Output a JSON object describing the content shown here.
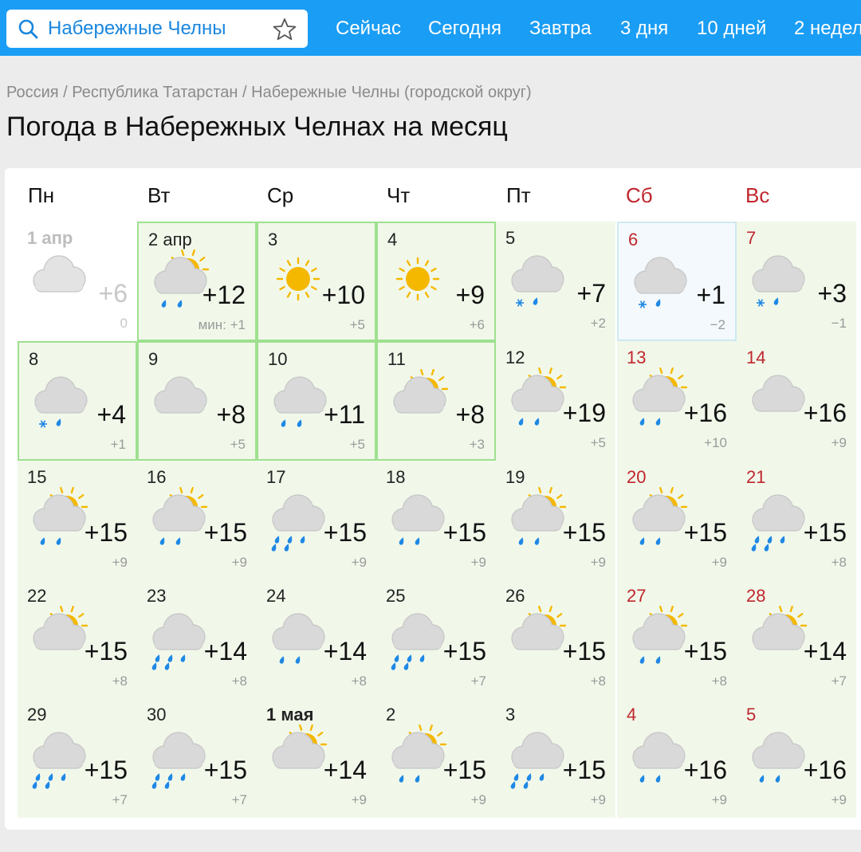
{
  "header": {
    "search_value": "Набережные Челны",
    "nav": [
      "Сейчас",
      "Сегодня",
      "Завтра",
      "3 дня",
      "10 дней",
      "2 недел"
    ]
  },
  "breadcrumb": [
    "Россия",
    "/",
    "Республика Татарстан",
    "/",
    "Набережные Челны (городской округ)"
  ],
  "page_title": "Погода в Набережных Челнах на месяц",
  "weekdays": [
    {
      "label": "Пн",
      "weekend": false
    },
    {
      "label": "Вт",
      "weekend": false
    },
    {
      "label": "Ср",
      "weekend": false
    },
    {
      "label": "Чт",
      "weekend": false
    },
    {
      "label": "Пт",
      "weekend": false
    },
    {
      "label": "Сб",
      "weekend": true
    },
    {
      "label": "Вс",
      "weekend": true
    }
  ],
  "colors": {
    "accent": "#1a9df4",
    "weekend": "#c0262d",
    "sun": "#f5b800",
    "rain": "#1e88e5",
    "cloud": "#d9d9d9"
  },
  "days": [
    {
      "date": "1 апр",
      "hi": "+6",
      "lo": "0",
      "icon": "cloud",
      "state": "past"
    },
    {
      "date": "2 апр",
      "hi": "+12",
      "lo": "мин: +1",
      "icon": "sun-cloud-rain",
      "state": "current"
    },
    {
      "date": "3",
      "hi": "+10",
      "lo": "+5",
      "icon": "sun",
      "state": "current"
    },
    {
      "date": "4",
      "hi": "+9",
      "lo": "+6",
      "icon": "sun",
      "state": "current"
    },
    {
      "date": "5",
      "hi": "+7",
      "lo": "+2",
      "icon": "cloud-snow-rain",
      "state": "normal"
    },
    {
      "date": "6",
      "hi": "+1",
      "lo": "−2",
      "icon": "cloud-snow-rain",
      "state": "cold",
      "weekend": true
    },
    {
      "date": "7",
      "hi": "+3",
      "lo": "−1",
      "icon": "cloud-snow-rain",
      "state": "normal",
      "weekend": true
    },
    {
      "date": "8",
      "hi": "+4",
      "lo": "+1",
      "icon": "cloud-snow-rain",
      "state": "current"
    },
    {
      "date": "9",
      "hi": "+8",
      "lo": "+5",
      "icon": "cloud",
      "state": "current"
    },
    {
      "date": "10",
      "hi": "+11",
      "lo": "+5",
      "icon": "cloud-rain",
      "state": "current"
    },
    {
      "date": "11",
      "hi": "+8",
      "lo": "+3",
      "icon": "sun-cloud",
      "state": "current"
    },
    {
      "date": "12",
      "hi": "+19",
      "lo": "+5",
      "icon": "sun-cloud-rain",
      "state": "normal"
    },
    {
      "date": "13",
      "hi": "+16",
      "lo": "+10",
      "icon": "sun-cloud-rain",
      "state": "normal",
      "weekend": true
    },
    {
      "date": "14",
      "hi": "+16",
      "lo": "+9",
      "icon": "cloud",
      "state": "normal",
      "weekend": true
    },
    {
      "date": "15",
      "hi": "+15",
      "lo": "+9",
      "icon": "sun-cloud-rain",
      "state": "normal"
    },
    {
      "date": "16",
      "hi": "+15",
      "lo": "+9",
      "icon": "sun-cloud-rain",
      "state": "normal"
    },
    {
      "date": "17",
      "hi": "+15",
      "lo": "+9",
      "icon": "cloud-heavy-rain",
      "state": "normal"
    },
    {
      "date": "18",
      "hi": "+15",
      "lo": "+9",
      "icon": "cloud-rain",
      "state": "normal"
    },
    {
      "date": "19",
      "hi": "+15",
      "lo": "+9",
      "icon": "sun-cloud-rain",
      "state": "normal"
    },
    {
      "date": "20",
      "hi": "+15",
      "lo": "+9",
      "icon": "sun-cloud-rain",
      "state": "normal",
      "weekend": true
    },
    {
      "date": "21",
      "hi": "+15",
      "lo": "+8",
      "icon": "cloud-heavy-rain",
      "state": "normal",
      "weekend": true
    },
    {
      "date": "22",
      "hi": "+15",
      "lo": "+8",
      "icon": "sun-cloud",
      "state": "normal"
    },
    {
      "date": "23",
      "hi": "+14",
      "lo": "+8",
      "icon": "cloud-heavy-rain",
      "state": "normal"
    },
    {
      "date": "24",
      "hi": "+14",
      "lo": "+8",
      "icon": "cloud-rain",
      "state": "normal"
    },
    {
      "date": "25",
      "hi": "+15",
      "lo": "+7",
      "icon": "cloud-heavy-rain",
      "state": "normal"
    },
    {
      "date": "26",
      "hi": "+15",
      "lo": "+8",
      "icon": "sun-cloud",
      "state": "normal"
    },
    {
      "date": "27",
      "hi": "+15",
      "lo": "+8",
      "icon": "sun-cloud-rain",
      "state": "normal",
      "weekend": true
    },
    {
      "date": "28",
      "hi": "+14",
      "lo": "+7",
      "icon": "sun-cloud",
      "state": "normal",
      "weekend": true
    },
    {
      "date": "29",
      "hi": "+15",
      "lo": "+7",
      "icon": "cloud-heavy-rain",
      "state": "normal"
    },
    {
      "date": "30",
      "hi": "+15",
      "lo": "+7",
      "icon": "cloud-heavy-rain",
      "state": "normal"
    },
    {
      "date": "1 мая",
      "hi": "+14",
      "lo": "+9",
      "icon": "sun-cloud",
      "state": "normal",
      "bold": true
    },
    {
      "date": "2",
      "hi": "+15",
      "lo": "+9",
      "icon": "sun-cloud-rain",
      "state": "normal"
    },
    {
      "date": "3",
      "hi": "+15",
      "lo": "+9",
      "icon": "cloud-heavy-rain",
      "state": "normal"
    },
    {
      "date": "4",
      "hi": "+16",
      "lo": "+9",
      "icon": "cloud-rain",
      "state": "normal",
      "weekend": true
    },
    {
      "date": "5",
      "hi": "+16",
      "lo": "+9",
      "icon": "cloud-rain",
      "state": "normal",
      "weekend": true
    }
  ]
}
